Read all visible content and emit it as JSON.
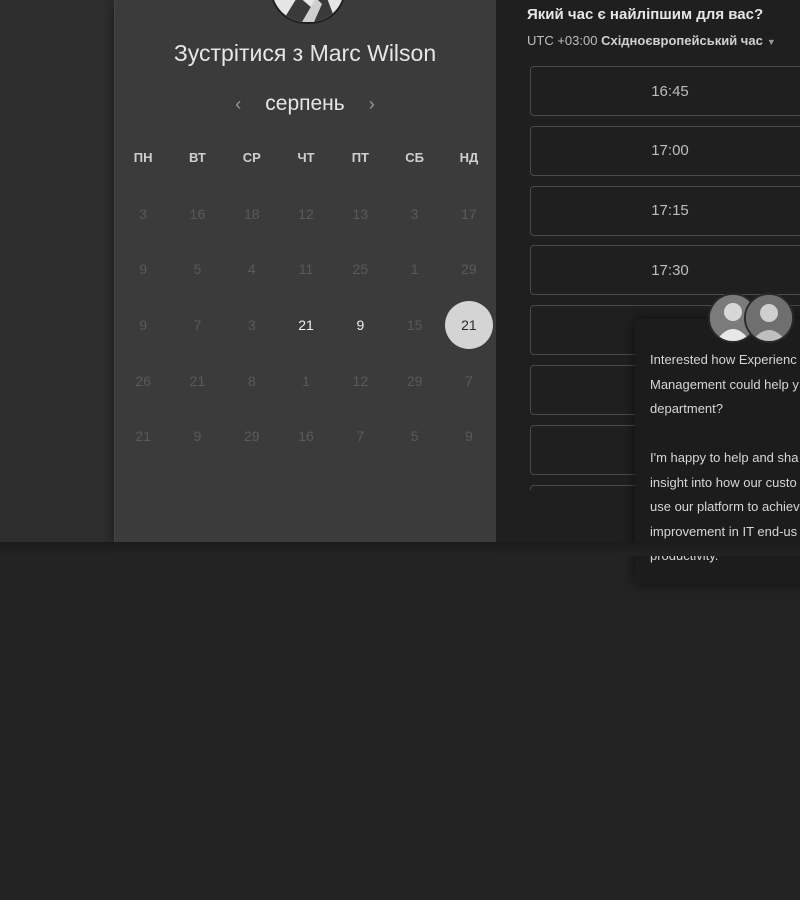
{
  "host": {
    "title": "Зустрітися з Marc Wilson"
  },
  "calendar": {
    "month": "серпень",
    "prev_icon": "‹",
    "next_icon": "›",
    "weekdays": [
      "ПН",
      "ВТ",
      "СР",
      "ЧТ",
      "ПТ",
      "СБ",
      "НД"
    ],
    "rows": [
      [
        "3",
        "16",
        "18",
        "12",
        "13",
        "3",
        "17"
      ],
      [
        "9",
        "5",
        "4",
        "11",
        "25",
        "1",
        "29"
      ],
      [
        "9",
        "7",
        "3",
        "21",
        "9",
        "15",
        "21"
      ],
      [
        "26",
        "21",
        "8",
        "1",
        "12",
        "29",
        "7"
      ],
      [
        "21",
        "9",
        "29",
        "16",
        "7",
        "5",
        "9"
      ]
    ],
    "available": [
      "2-3",
      "2-4",
      "2-6"
    ],
    "selected": "2-6"
  },
  "times": {
    "question": "Який час є найліпшим для вас?",
    "tz_offset": "UTC +03:00",
    "tz_name": "Східноєвропейський час",
    "slots": [
      "16:45",
      "17:00",
      "17:15",
      "17:30",
      "",
      "",
      "",
      ""
    ]
  },
  "chat": {
    "message": "Interested how Experienc\nManagement could help y\ndepartment?\n\nI'm happy to help and sha\ninsight into how our custo\nuse our platform to achiev\nimprovement in IT end-us\nproductivity."
  },
  "colors": {
    "selected_bg": "#d4d4d4",
    "panel_bg": "#3b3b3b",
    "right_bg": "#1f1f1f"
  }
}
